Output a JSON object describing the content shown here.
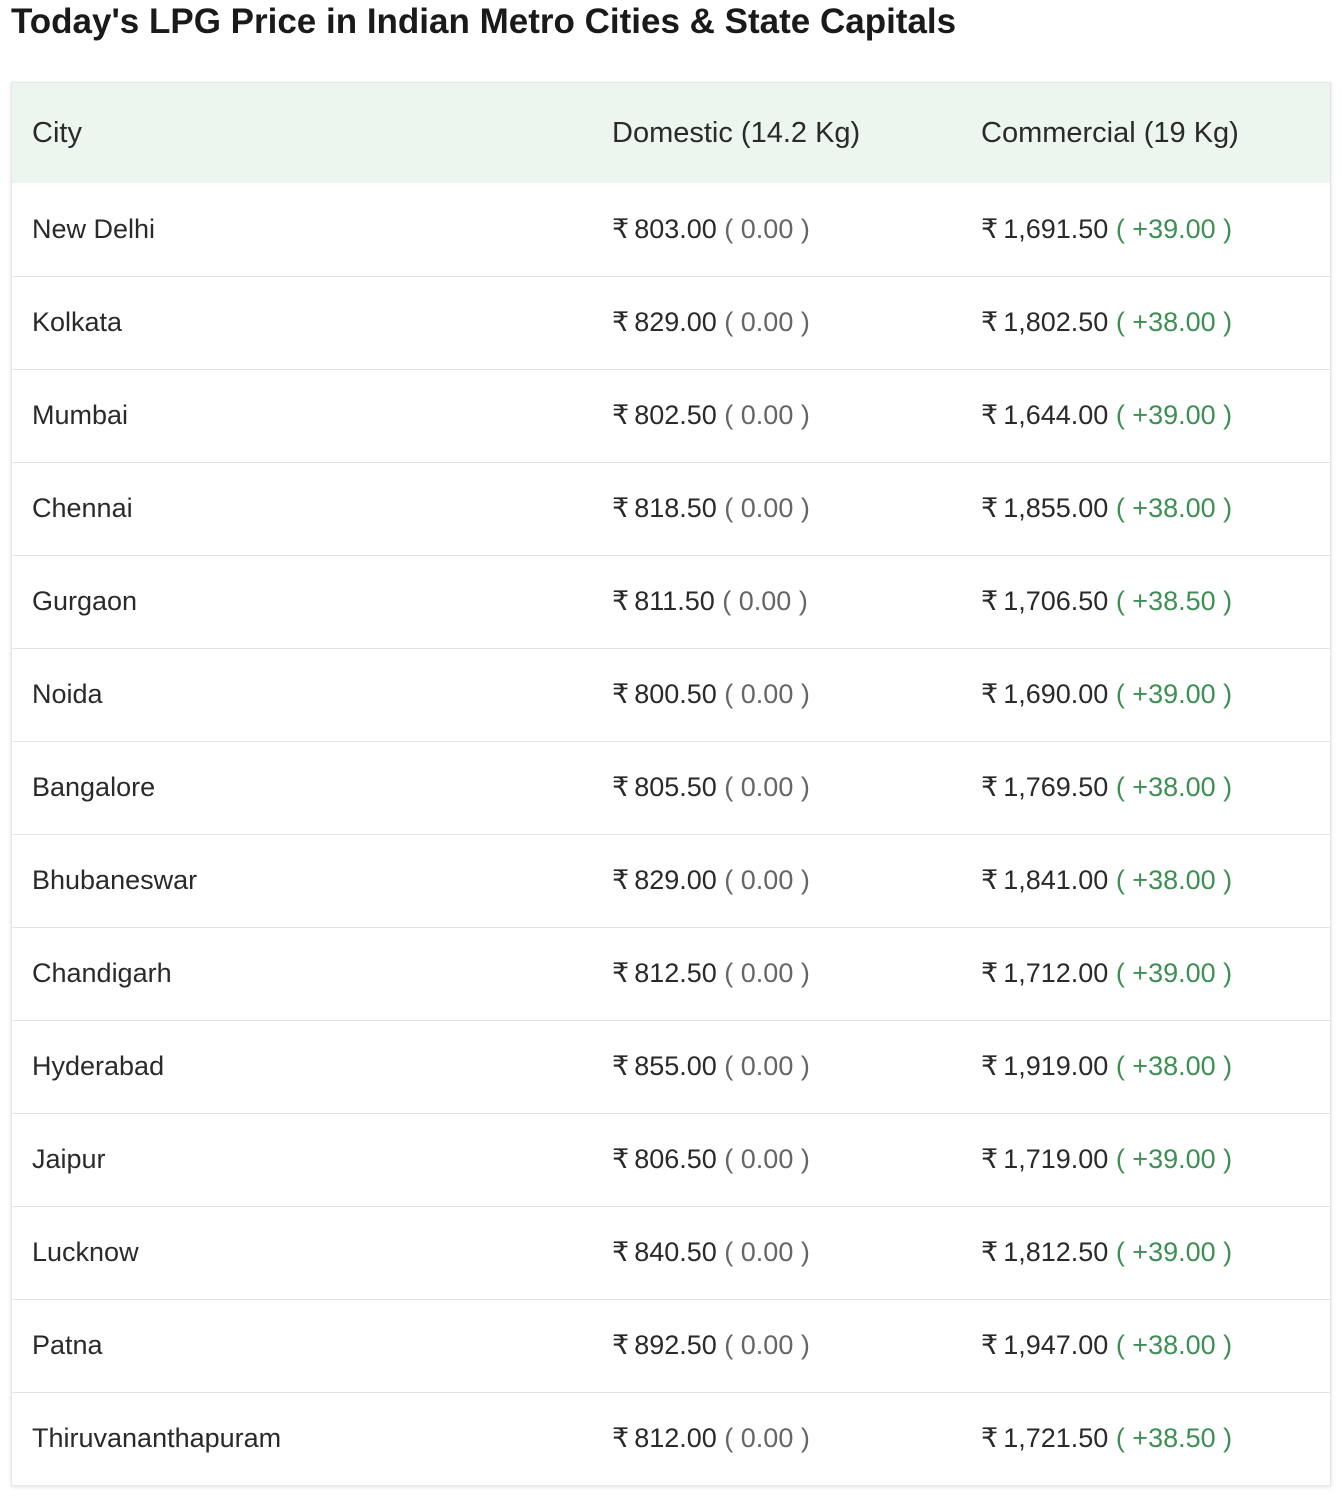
{
  "page": {
    "title": "Today's LPG Price in Indian Metro Cities & State Capitals"
  },
  "table": {
    "headers": {
      "city": "City",
      "domestic": "Domestic (14.2 Kg)",
      "commercial": "Commercial (19 Kg)"
    },
    "currency_symbol": "₹",
    "rows": [
      {
        "city": "New Delhi",
        "domestic_price": "803.00",
        "domestic_change": "( 0.00 )",
        "commercial_price": "1,691.50",
        "commercial_change": "( +39.00 )"
      },
      {
        "city": "Kolkata",
        "domestic_price": "829.00",
        "domestic_change": "( 0.00 )",
        "commercial_price": "1,802.50",
        "commercial_change": "( +38.00 )"
      },
      {
        "city": "Mumbai",
        "domestic_price": "802.50",
        "domestic_change": "( 0.00 )",
        "commercial_price": "1,644.00",
        "commercial_change": "( +39.00 )"
      },
      {
        "city": "Chennai",
        "domestic_price": "818.50",
        "domestic_change": "( 0.00 )",
        "commercial_price": "1,855.00",
        "commercial_change": "( +38.00 )"
      },
      {
        "city": "Gurgaon",
        "domestic_price": "811.50",
        "domestic_change": "( 0.00 )",
        "commercial_price": "1,706.50",
        "commercial_change": "( +38.50 )"
      },
      {
        "city": "Noida",
        "domestic_price": "800.50",
        "domestic_change": "( 0.00 )",
        "commercial_price": "1,690.00",
        "commercial_change": "( +39.00 )"
      },
      {
        "city": "Bangalore",
        "domestic_price": "805.50",
        "domestic_change": "( 0.00 )",
        "commercial_price": "1,769.50",
        "commercial_change": "( +38.00 )"
      },
      {
        "city": "Bhubaneswar",
        "domestic_price": "829.00",
        "domestic_change": "( 0.00 )",
        "commercial_price": "1,841.00",
        "commercial_change": "( +38.00 )"
      },
      {
        "city": "Chandigarh",
        "domestic_price": "812.50",
        "domestic_change": "( 0.00 )",
        "commercial_price": "1,712.00",
        "commercial_change": "( +39.00 )"
      },
      {
        "city": "Hyderabad",
        "domestic_price": "855.00",
        "domestic_change": "( 0.00 )",
        "commercial_price": "1,919.00",
        "commercial_change": "( +38.00 )"
      },
      {
        "city": "Jaipur",
        "domestic_price": "806.50",
        "domestic_change": "( 0.00 )",
        "commercial_price": "1,719.00",
        "commercial_change": "( +39.00 )"
      },
      {
        "city": "Lucknow",
        "domestic_price": "840.50",
        "domestic_change": "( 0.00 )",
        "commercial_price": "1,812.50",
        "commercial_change": "( +39.00 )"
      },
      {
        "city": "Patna",
        "domestic_price": "892.50",
        "domestic_change": "( 0.00 )",
        "commercial_price": "1,947.00",
        "commercial_change": "( +38.00 )"
      },
      {
        "city": "Thiruvananthapuram",
        "domestic_price": "812.00",
        "domestic_change": "( 0.00 )",
        "commercial_price": "1,721.50",
        "commercial_change": "( +38.50 )"
      }
    ]
  },
  "colors": {
    "header_background": "#ecf6ee",
    "change_up": "#3d8f54",
    "change_neutral": "#666666"
  }
}
